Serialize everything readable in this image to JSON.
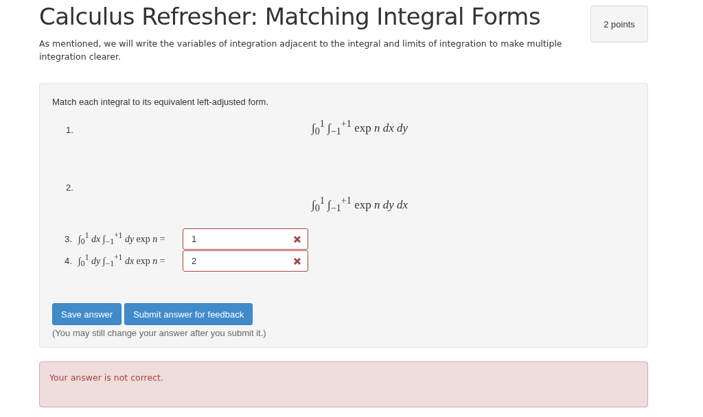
{
  "title": "Calculus Refresher: Matching Integral Forms",
  "points": "2 points",
  "intro": "As mentioned, we will write the variables of integration adjacent to the integral and limits of integration to make multiple integration clearer.",
  "question": {
    "prompt": "Match each integral to its equivalent left-adjusted form.",
    "options": [
      {
        "label": "1.",
        "formula": "∫$_{0}$$^{1}$ ∫$_{−1}$$^{+1}$ exp *n* *dx* *dy*"
      },
      {
        "label": "2.",
        "formula": "∫$_{0}$$^{1}$ ∫$_{−1}$$^{+1}$ exp *n* *dy* *dx*"
      }
    ],
    "items": [
      {
        "label": "3.",
        "formula": "∫$_{0}$$^{1}$ *dx* ∫$_{−1}$$^{+1}$ *dy* exp *n* =",
        "value": "1",
        "correct": false
      },
      {
        "label": "4.",
        "formula": "∫$_{0}$$^{1}$ *dy* ∫$_{−1}$$^{+1}$ *dx* exp *n* =",
        "value": "2",
        "correct": false
      }
    ],
    "buttons": [
      "Save answer",
      "Submit answer for feedback"
    ],
    "note": "(You may still change your answer after you submit it.)"
  },
  "feedback": {
    "text": "Your answer is not correct.",
    "correct": false
  }
}
